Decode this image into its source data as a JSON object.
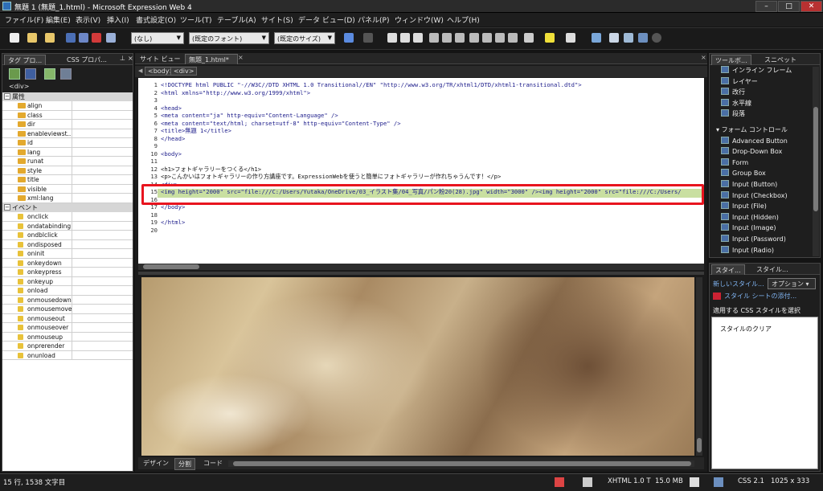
{
  "window": {
    "title": "無題 1 (無題_1.html) - Microsoft Expression Web 4"
  },
  "menu": [
    "ファイル(F)",
    "編集(E)",
    "表示(V)",
    "挿入(I)",
    "書式設定(O)",
    "ツール(T)",
    "テーブル(A)",
    "サイト(S)",
    "データ ビュー(D)",
    "パネル(P)",
    "ウィンドウ(W)",
    "ヘルプ(H)"
  ],
  "toolbar": {
    "style_value": "(なし)",
    "font_value": "(既定のフォント)",
    "size_value": "(既定のサイズ)"
  },
  "left_panel": {
    "tabs": [
      "タグ プロ...",
      "CSS プロパ..."
    ],
    "selected_tag": "<div>",
    "attributes_header": "属性",
    "attributes": [
      "align",
      "class",
      "dir",
      "enableviewst...",
      "id",
      "lang",
      "runat",
      "style",
      "title",
      "visible",
      "xml:lang"
    ],
    "events_header": "イベント",
    "events": [
      "onclick",
      "ondatabinding",
      "ondblclick",
      "ondisposed",
      "oninit",
      "onkeydown",
      "onkeypress",
      "onkeyup",
      "onload",
      "onmousedown",
      "onmousemove",
      "onmouseout",
      "onmouseover",
      "onmouseup",
      "onprerender",
      "onunload"
    ]
  },
  "editor": {
    "tabs": [
      "サイト ビュー",
      "無題_1.html*"
    ],
    "breadcrumb": [
      "<body>",
      "<div>"
    ],
    "lines": [
      {
        "n": "1",
        "t": "<!DOCTYPE html PUBLIC \"-//W3C//DTD XHTML 1.0 Transitional//EN\" \"http://www.w3.org/TR/xhtml1/DTD/xhtml1-transitional.dtd\">"
      },
      {
        "n": "2",
        "t": "<html xmlns=\"http://www.w3.org/1999/xhtml\">"
      },
      {
        "n": "3",
        "t": ""
      },
      {
        "n": "4",
        "t": "<head>"
      },
      {
        "n": "5",
        "t": "<meta content=\"ja\" http-equiv=\"Content-Language\" />"
      },
      {
        "n": "6",
        "t": "<meta content=\"text/html; charset=utf-8\" http-equiv=\"Content-Type\" />"
      },
      {
        "n": "7",
        "t": "<title>無題 1</title>"
      },
      {
        "n": "8",
        "t": "</head>"
      },
      {
        "n": "9",
        "t": ""
      },
      {
        "n": "10",
        "t": "<body>"
      },
      {
        "n": "11",
        "t": ""
      },
      {
        "n": "12",
        "t": "<h1>フォトギャラリーをつくる</h1>"
      },
      {
        "n": "13",
        "t": "<p>こんかいはフォトギャラリーの作り方講座です。ExpressionWebを使うと簡単にフォトギャラリーが作れちゃうんです！</p>"
      },
      {
        "n": "14",
        "t": "<div>"
      },
      {
        "n": "15",
        "t": "    <img height=\"2000\" src=\"file:///C:/Users/Yutaka/OneDrive/03_イラスト集/04_写真/パン粉20(28).jpg\" width=\"3000\" /><img height=\"2000\" src=\"file:///C:/Users/"
      },
      {
        "n": "16",
        "t": ""
      },
      {
        "n": "17",
        "t": "</body>"
      },
      {
        "n": "18",
        "t": ""
      },
      {
        "n": "19",
        "t": "</html>"
      },
      {
        "n": "20",
        "t": ""
      }
    ],
    "view_tabs": [
      "デザイン",
      "分割",
      "コード"
    ]
  },
  "toolbox": {
    "tabs": [
      "ツールボ...",
      "スニペット"
    ],
    "items_top": [
      "インライン フレーム",
      "レイヤー",
      "改行",
      "水平線",
      "段落"
    ],
    "group": "フォーム コントロール",
    "items_form": [
      "Advanced Button",
      "Drop-Down Box",
      "Form",
      "Group Box",
      "Input (Button)",
      "Input (Checkbox)",
      "Input (File)",
      "Input (Hidden)",
      "Input (Image)",
      "Input (Password)",
      "Input (Radio)"
    ]
  },
  "styles": {
    "tabs": [
      "スタイ...",
      "スタイル..."
    ],
    "new_style": "新しいスタイル...",
    "options": "オプション",
    "attach": "スタイル シートの添付...",
    "apply_label": "適用する CSS スタイルを選択",
    "clear": "スタイルのクリア"
  },
  "status": {
    "position": "15 行, 1538 文字目",
    "doctype": "XHTML 1.0 T",
    "size": "15.0 MB",
    "css": "CSS 2.1",
    "dimensions": "1025 x 333"
  }
}
